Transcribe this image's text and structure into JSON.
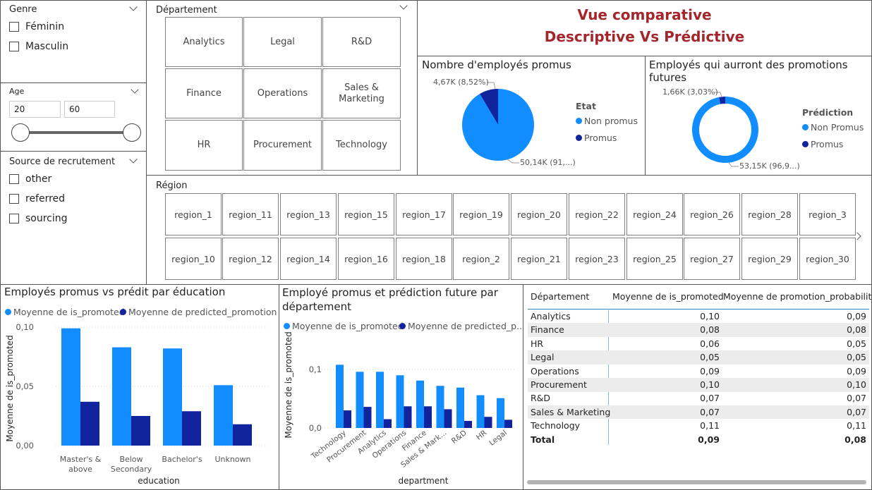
{
  "colors": {
    "light_blue": "#118DFF",
    "dark_blue": "#12239E",
    "title_red": "#A4262C"
  },
  "gender_slicer": {
    "title": "Genre",
    "options": [
      "Féminin",
      "Masculin"
    ]
  },
  "age_slicer": {
    "title": "Age",
    "min_value": "20",
    "max_value": "60"
  },
  "source_slicer": {
    "title": "Source de recrutement",
    "options": [
      "other",
      "referred",
      "sourcing"
    ]
  },
  "department_slicer": {
    "title": "Département",
    "tiles": [
      "Analytics",
      "Legal",
      "R&D",
      "Finance",
      "Operations",
      "Sales & Marketing",
      "HR",
      "Procurement",
      "Technology"
    ]
  },
  "header": {
    "line1": "Vue comparative",
    "line2": "Descriptive Vs Prédictive"
  },
  "pie_promoted": {
    "title": "Nombre d'employés promus",
    "legend_title": "Etat",
    "label_small": "4,67K (8,52%)",
    "label_large": "50,14K (91,...)",
    "chart_data": {
      "type": "pie",
      "categories": [
        "Non promus",
        "Promus"
      ],
      "values": [
        50140,
        4670
      ],
      "legend": "right"
    }
  },
  "donut_future": {
    "title": "Employés qui aurront des promotions futures",
    "legend_title": "Prédiction",
    "label_small": "1,66K (3,03%)",
    "label_large": "53,15K (96,9...)",
    "chart_data": {
      "type": "pie",
      "categories": [
        "Non Promus",
        "Promus"
      ],
      "values": [
        53150,
        1660
      ],
      "legend": "right"
    }
  },
  "region_slicer": {
    "title": "Région",
    "row1": [
      "region_1",
      "region_11",
      "region_13",
      "region_15",
      "region_17",
      "region_19",
      "region_20",
      "region_22",
      "region_24",
      "region_26",
      "region_28",
      "region_3"
    ],
    "row2": [
      "region_10",
      "region_12",
      "region_14",
      "region_16",
      "region_18",
      "region_2",
      "region_21",
      "region_23",
      "region_25",
      "region_27",
      "region_29",
      "region_30"
    ]
  },
  "edu_chart": {
    "title": "Employés promus vs prédit par éducation",
    "legend": [
      "Moyenne de is_promoted",
      "Moyenne de predicted_promotion"
    ],
    "chart_data": {
      "type": "bar",
      "categories": [
        "Master's & above",
        "Below Secondary",
        "Bachelor's",
        "Unknown"
      ],
      "category_lines": [
        [
          "Master's &",
          "above"
        ],
        [
          "Below",
          "Secondary"
        ],
        [
          "Bachelor's"
        ],
        [
          "Unknown"
        ]
      ],
      "series": [
        {
          "name": "Moyenne de is_promoted",
          "values": [
            0.099,
            0.083,
            0.082,
            0.051
          ]
        },
        {
          "name": "Moyenne de predicted_promotion",
          "values": [
            0.037,
            0.025,
            0.029,
            0.018
          ]
        }
      ],
      "xlabel": "education",
      "ylabel": "Moyenne de is_promoted",
      "ylim": [
        0,
        0.1
      ],
      "yticks": [
        "0,00",
        "0,05",
        "0,10"
      ],
      "legend": "top-left",
      "grid": true
    }
  },
  "dept_chart": {
    "title": "Employé promus et prédiction future par département",
    "title_lines": [
      "Employé promus et prédiction future par",
      "département"
    ],
    "legend": [
      "Moyenne de is_promoted",
      "Moyenne de predicted_p..."
    ],
    "chart_data": {
      "type": "bar",
      "categories": [
        "Technology",
        "Procurement",
        "Analytics",
        "Operations",
        "Finance",
        "Sales & Mark...",
        "R&D",
        "HR",
        "Legal"
      ],
      "series": [
        {
          "name": "Moyenne de is_promoted",
          "values": [
            0.108,
            0.096,
            0.096,
            0.09,
            0.081,
            0.072,
            0.069,
            0.056,
            0.051
          ]
        },
        {
          "name": "Moyenne de predicted_p...",
          "values": [
            0.03,
            0.036,
            0.015,
            0.037,
            0.037,
            0.032,
            0.012,
            0.019,
            0.014
          ]
        }
      ],
      "xlabel": "department",
      "ylabel": "Moyenne de is_promoted",
      "ylim": [
        0,
        0.12
      ],
      "yticks": [
        "0,0",
        "0,1"
      ],
      "legend": "top-left",
      "grid": true
    }
  },
  "dept_table": {
    "headers": [
      "Département",
      "Moyenne de is_promoted",
      "Moyenne de promotion_probability"
    ],
    "rows": [
      [
        "Analytics",
        "0,10",
        "0,09"
      ],
      [
        "Finance",
        "0,08",
        "0,08"
      ],
      [
        "HR",
        "0,06",
        "0,05"
      ],
      [
        "Legal",
        "0,05",
        "0,05"
      ],
      [
        "Operations",
        "0,09",
        "0,09"
      ],
      [
        "Procurement",
        "0,10",
        "0,10"
      ],
      [
        "R&D",
        "0,07",
        "0,07"
      ],
      [
        "Sales & Marketing",
        "0,07",
        "0,07"
      ],
      [
        "Technology",
        "0,11",
        "0,11"
      ]
    ],
    "total": [
      "Total",
      "0,09",
      "0,08"
    ]
  }
}
